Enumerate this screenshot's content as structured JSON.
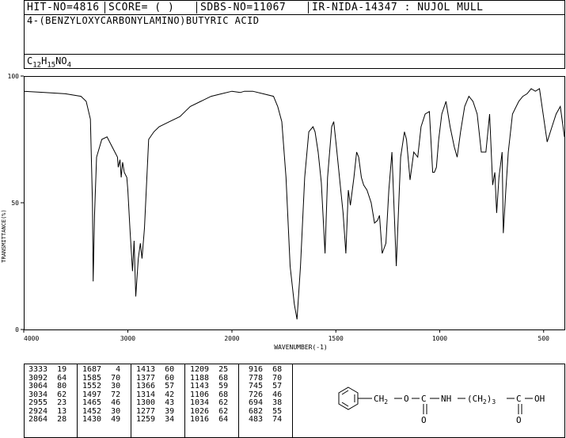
{
  "header": {
    "hit_no": "HIT-NO=4816",
    "score": "SCORE=  (    )",
    "sdbs_no": "SDBS-NO=11067",
    "ir_no": "IR-NIDA-14347 : NUJOL MULL",
    "compound_name": "4-(BENZYLOXYCARBONYLAMINO)BUTYRIC ACID",
    "formula": {
      "c": "C",
      "c_n": "12",
      "h": "H",
      "h_n": "15",
      "rest": "NO",
      "o_n": "4"
    }
  },
  "chart_data": {
    "type": "line",
    "xlabel": "WAVENUMBER(-1)",
    "ylabel": "TRANSMITTANCE(%)",
    "xlim": [
      4000,
      400
    ],
    "ylim": [
      0,
      100
    ],
    "x_ticks": [
      "4000",
      "3000",
      "2000",
      "1500",
      "1000",
      "500"
    ],
    "y_ticks": [
      "100",
      "50",
      "0"
    ],
    "series": [
      {
        "x": [
          4000,
          3800,
          3600,
          3450,
          3400,
          3360,
          3340,
          3333,
          3320,
          3300,
          3250,
          3200,
          3150,
          3100,
          3092,
          3075,
          3064,
          3050,
          3034,
          3010,
          3000,
          2980,
          2955,
          2940,
          2924,
          2900,
          2880,
          2864,
          2840,
          2800,
          2750,
          2700,
          2600,
          2500,
          2450,
          2400,
          2300,
          2200,
          2100,
          2000,
          1960,
          1940,
          1900,
          1850,
          1800,
          1780,
          1760,
          1740,
          1720,
          1700,
          1687,
          1670,
          1650,
          1630,
          1610,
          1600,
          1585,
          1570,
          1552,
          1540,
          1520,
          1510,
          1497,
          1480,
          1465,
          1452,
          1440,
          1430,
          1413,
          1400,
          1390,
          1377,
          1366,
          1350,
          1330,
          1314,
          1300,
          1290,
          1277,
          1259,
          1245,
          1230,
          1209,
          1188,
          1170,
          1160,
          1143,
          1125,
          1106,
          1090,
          1070,
          1050,
          1034,
          1026,
          1016,
          1005,
          990,
          970,
          950,
          930,
          916,
          900,
          880,
          860,
          840,
          820,
          800,
          778,
          760,
          745,
          735,
          726,
          715,
          700,
          694,
          682,
          670,
          650,
          620,
          600,
          580,
          560,
          540,
          520,
          483,
          460,
          440,
          420,
          400
        ],
        "y": [
          94,
          93.5,
          93,
          92,
          90,
          83,
          50,
          19,
          45,
          68,
          75,
          76,
          72,
          68,
          64,
          67,
          60,
          66,
          62,
          60,
          55,
          40,
          23,
          35,
          13,
          28,
          34,
          28,
          40,
          75,
          78,
          80,
          82,
          84,
          86,
          88,
          90,
          92,
          93,
          94,
          93.5,
          94,
          94,
          93,
          92,
          88,
          82,
          60,
          25,
          10,
          4,
          25,
          60,
          78,
          80,
          78,
          70,
          58,
          30,
          60,
          80,
          82,
          72,
          58,
          46,
          30,
          55,
          49,
          60,
          70,
          68,
          60,
          57,
          55,
          50,
          42,
          43,
          45,
          30,
          34,
          55,
          70,
          25,
          68,
          78,
          75,
          59,
          70,
          68,
          80,
          85,
          86,
          62,
          62,
          64,
          75,
          85,
          90,
          80,
          72,
          68,
          78,
          88,
          92,
          90,
          85,
          70,
          70,
          85,
          57,
          62,
          46,
          60,
          70,
          38,
          55,
          70,
          85,
          90,
          92,
          93,
          95,
          94,
          95,
          74,
          80,
          85,
          88,
          76
        ]
      }
    ]
  },
  "peak_table": [
    [
      "3333",
      "19",
      "1687",
      "4",
      "1413",
      "60",
      "1209",
      "25",
      "916",
      "68"
    ],
    [
      "3092",
      "64",
      "1585",
      "70",
      "1377",
      "60",
      "1188",
      "68",
      "778",
      "70"
    ],
    [
      "3064",
      "80",
      "1552",
      "30",
      "1366",
      "57",
      "1143",
      "59",
      "745",
      "57"
    ],
    [
      "3034",
      "62",
      "1497",
      "72",
      "1314",
      "42",
      "1106",
      "68",
      "726",
      "46"
    ],
    [
      "2955",
      "23",
      "1465",
      "46",
      "1300",
      "43",
      "1034",
      "62",
      "694",
      "38"
    ],
    [
      "2924",
      "13",
      "1452",
      "30",
      "1277",
      "39",
      "1026",
      "62",
      "682",
      "55"
    ],
    [
      "2864",
      "28",
      "1430",
      "49",
      "1259",
      "34",
      "1016",
      "64",
      "483",
      "74"
    ]
  ],
  "structure": {
    "chain1": "CH",
    "chain1_sub": "2",
    "o1": "O",
    "c1": "C",
    "o_dbl1": "O",
    "nh": "NH",
    "chain2": "(CH",
    "chain2_sub": "2",
    "chain2_n": "3",
    "c2": "C",
    "oh": "OH",
    "o_dbl2": "O"
  }
}
